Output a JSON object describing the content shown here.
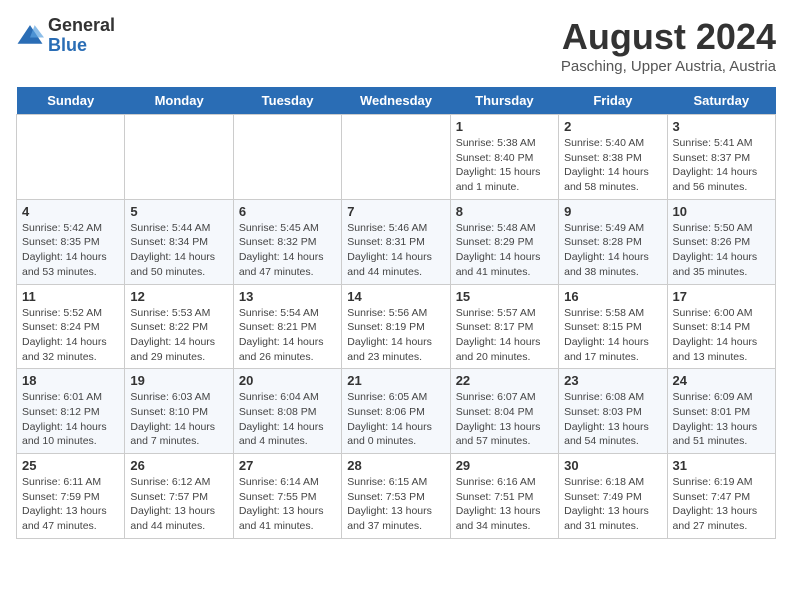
{
  "logo": {
    "general": "General",
    "blue": "Blue"
  },
  "title": "August 2024",
  "subtitle": "Pasching, Upper Austria, Austria",
  "headers": [
    "Sunday",
    "Monday",
    "Tuesday",
    "Wednesday",
    "Thursday",
    "Friday",
    "Saturday"
  ],
  "weeks": [
    [
      {
        "day": "",
        "sunrise": "",
        "sunset": "",
        "daylight": ""
      },
      {
        "day": "",
        "sunrise": "",
        "sunset": "",
        "daylight": ""
      },
      {
        "day": "",
        "sunrise": "",
        "sunset": "",
        "daylight": ""
      },
      {
        "day": "",
        "sunrise": "",
        "sunset": "",
        "daylight": ""
      },
      {
        "day": "1",
        "sunrise": "Sunrise: 5:38 AM",
        "sunset": "Sunset: 8:40 PM",
        "daylight": "Daylight: 15 hours and 1 minute."
      },
      {
        "day": "2",
        "sunrise": "Sunrise: 5:40 AM",
        "sunset": "Sunset: 8:38 PM",
        "daylight": "Daylight: 14 hours and 58 minutes."
      },
      {
        "day": "3",
        "sunrise": "Sunrise: 5:41 AM",
        "sunset": "Sunset: 8:37 PM",
        "daylight": "Daylight: 14 hours and 56 minutes."
      }
    ],
    [
      {
        "day": "4",
        "sunrise": "Sunrise: 5:42 AM",
        "sunset": "Sunset: 8:35 PM",
        "daylight": "Daylight: 14 hours and 53 minutes."
      },
      {
        "day": "5",
        "sunrise": "Sunrise: 5:44 AM",
        "sunset": "Sunset: 8:34 PM",
        "daylight": "Daylight: 14 hours and 50 minutes."
      },
      {
        "day": "6",
        "sunrise": "Sunrise: 5:45 AM",
        "sunset": "Sunset: 8:32 PM",
        "daylight": "Daylight: 14 hours and 47 minutes."
      },
      {
        "day": "7",
        "sunrise": "Sunrise: 5:46 AM",
        "sunset": "Sunset: 8:31 PM",
        "daylight": "Daylight: 14 hours and 44 minutes."
      },
      {
        "day": "8",
        "sunrise": "Sunrise: 5:48 AM",
        "sunset": "Sunset: 8:29 PM",
        "daylight": "Daylight: 14 hours and 41 minutes."
      },
      {
        "day": "9",
        "sunrise": "Sunrise: 5:49 AM",
        "sunset": "Sunset: 8:28 PM",
        "daylight": "Daylight: 14 hours and 38 minutes."
      },
      {
        "day": "10",
        "sunrise": "Sunrise: 5:50 AM",
        "sunset": "Sunset: 8:26 PM",
        "daylight": "Daylight: 14 hours and 35 minutes."
      }
    ],
    [
      {
        "day": "11",
        "sunrise": "Sunrise: 5:52 AM",
        "sunset": "Sunset: 8:24 PM",
        "daylight": "Daylight: 14 hours and 32 minutes."
      },
      {
        "day": "12",
        "sunrise": "Sunrise: 5:53 AM",
        "sunset": "Sunset: 8:22 PM",
        "daylight": "Daylight: 14 hours and 29 minutes."
      },
      {
        "day": "13",
        "sunrise": "Sunrise: 5:54 AM",
        "sunset": "Sunset: 8:21 PM",
        "daylight": "Daylight: 14 hours and 26 minutes."
      },
      {
        "day": "14",
        "sunrise": "Sunrise: 5:56 AM",
        "sunset": "Sunset: 8:19 PM",
        "daylight": "Daylight: 14 hours and 23 minutes."
      },
      {
        "day": "15",
        "sunrise": "Sunrise: 5:57 AM",
        "sunset": "Sunset: 8:17 PM",
        "daylight": "Daylight: 14 hours and 20 minutes."
      },
      {
        "day": "16",
        "sunrise": "Sunrise: 5:58 AM",
        "sunset": "Sunset: 8:15 PM",
        "daylight": "Daylight: 14 hours and 17 minutes."
      },
      {
        "day": "17",
        "sunrise": "Sunrise: 6:00 AM",
        "sunset": "Sunset: 8:14 PM",
        "daylight": "Daylight: 14 hours and 13 minutes."
      }
    ],
    [
      {
        "day": "18",
        "sunrise": "Sunrise: 6:01 AM",
        "sunset": "Sunset: 8:12 PM",
        "daylight": "Daylight: 14 hours and 10 minutes."
      },
      {
        "day": "19",
        "sunrise": "Sunrise: 6:03 AM",
        "sunset": "Sunset: 8:10 PM",
        "daylight": "Daylight: 14 hours and 7 minutes."
      },
      {
        "day": "20",
        "sunrise": "Sunrise: 6:04 AM",
        "sunset": "Sunset: 8:08 PM",
        "daylight": "Daylight: 14 hours and 4 minutes."
      },
      {
        "day": "21",
        "sunrise": "Sunrise: 6:05 AM",
        "sunset": "Sunset: 8:06 PM",
        "daylight": "Daylight: 14 hours and 0 minutes."
      },
      {
        "day": "22",
        "sunrise": "Sunrise: 6:07 AM",
        "sunset": "Sunset: 8:04 PM",
        "daylight": "Daylight: 13 hours and 57 minutes."
      },
      {
        "day": "23",
        "sunrise": "Sunrise: 6:08 AM",
        "sunset": "Sunset: 8:03 PM",
        "daylight": "Daylight: 13 hours and 54 minutes."
      },
      {
        "day": "24",
        "sunrise": "Sunrise: 6:09 AM",
        "sunset": "Sunset: 8:01 PM",
        "daylight": "Daylight: 13 hours and 51 minutes."
      }
    ],
    [
      {
        "day": "25",
        "sunrise": "Sunrise: 6:11 AM",
        "sunset": "Sunset: 7:59 PM",
        "daylight": "Daylight: 13 hours and 47 minutes."
      },
      {
        "day": "26",
        "sunrise": "Sunrise: 6:12 AM",
        "sunset": "Sunset: 7:57 PM",
        "daylight": "Daylight: 13 hours and 44 minutes."
      },
      {
        "day": "27",
        "sunrise": "Sunrise: 6:14 AM",
        "sunset": "Sunset: 7:55 PM",
        "daylight": "Daylight: 13 hours and 41 minutes."
      },
      {
        "day": "28",
        "sunrise": "Sunrise: 6:15 AM",
        "sunset": "Sunset: 7:53 PM",
        "daylight": "Daylight: 13 hours and 37 minutes."
      },
      {
        "day": "29",
        "sunrise": "Sunrise: 6:16 AM",
        "sunset": "Sunset: 7:51 PM",
        "daylight": "Daylight: 13 hours and 34 minutes."
      },
      {
        "day": "30",
        "sunrise": "Sunrise: 6:18 AM",
        "sunset": "Sunset: 7:49 PM",
        "daylight": "Daylight: 13 hours and 31 minutes."
      },
      {
        "day": "31",
        "sunrise": "Sunrise: 6:19 AM",
        "sunset": "Sunset: 7:47 PM",
        "daylight": "Daylight: 13 hours and 27 minutes."
      }
    ]
  ]
}
